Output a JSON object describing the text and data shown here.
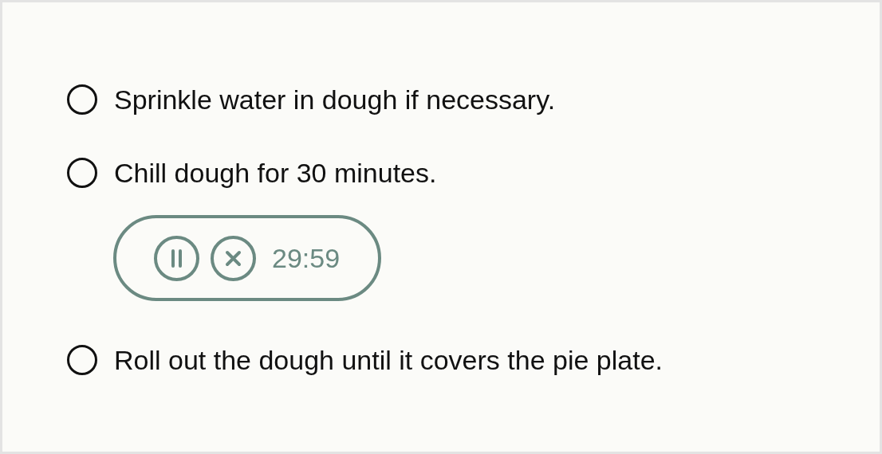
{
  "steps": [
    {
      "text": "Sprinkle water in dough if necessary.",
      "checked": false
    },
    {
      "text": "Chill dough for 30 minutes.",
      "checked": false,
      "timer": {
        "time": "29:59",
        "paused": false
      }
    },
    {
      "text": "Roll out the dough until it covers the pie plate.",
      "checked": false
    }
  ]
}
